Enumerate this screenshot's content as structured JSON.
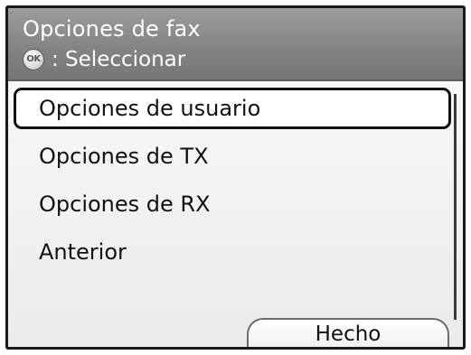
{
  "header": {
    "title": "Opciones de fax",
    "ok_icon_label": "OK",
    "hint": ": Seleccionar"
  },
  "menu": {
    "items": [
      {
        "label": "Opciones de usuario",
        "selected": true
      },
      {
        "label": "Opciones de TX",
        "selected": false
      },
      {
        "label": "Opciones de RX",
        "selected": false
      },
      {
        "label": "Anterior",
        "selected": false
      }
    ]
  },
  "footer": {
    "done_label": "Hecho"
  }
}
